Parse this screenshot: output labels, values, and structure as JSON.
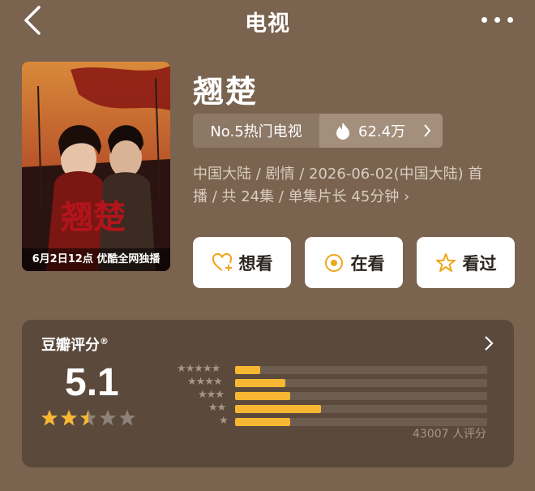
{
  "header": {
    "title": "电视",
    "back_icon": "chevron-left-icon",
    "more_icon": "ellipsis-icon"
  },
  "show": {
    "title": "翘楚",
    "poster_caption": "6月2日12点 优酷全网独播",
    "rank_label": "No.5热门电视",
    "heat_value": "62.4万",
    "meta_line1": "中国大陆 / 剧情 / 2026-06-02(中国大陆) 首",
    "meta_line2": "播 / 共 24集 / 单集片长 45分钟 ›"
  },
  "actions": [
    {
      "label": "想看",
      "icon": "heart-plus-icon"
    },
    {
      "label": "在看",
      "icon": "target-icon"
    },
    {
      "label": "看过",
      "icon": "star-outline-icon"
    }
  ],
  "rating": {
    "label": "豆瓣评分",
    "score": "5.1",
    "stars_value": 2.5,
    "star_labels": [
      "★★★★★",
      "★★★★",
      "★★★",
      "★★",
      "★"
    ],
    "distribution": [
      0.1,
      0.2,
      0.22,
      0.34,
      0.22
    ],
    "count_text": "43007 人评分"
  },
  "colors": {
    "accent": "#f7b733",
    "background": "#7a634f",
    "card": "#5b4a3c"
  }
}
